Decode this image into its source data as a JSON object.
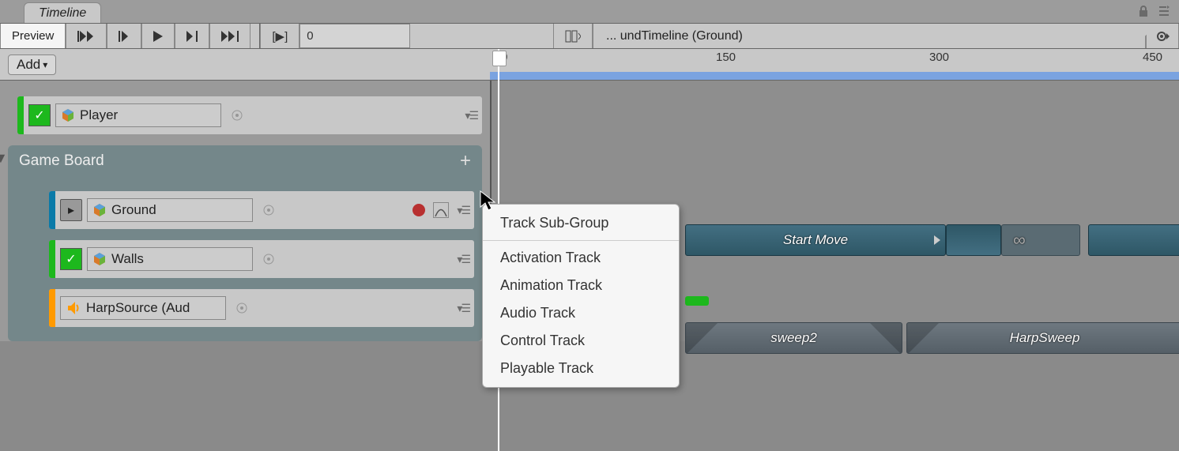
{
  "tab": {
    "title": "Timeline"
  },
  "toolbar": {
    "preview": "Preview",
    "frame": "0",
    "breadcrumb_text": "... undTimeline (Ground)"
  },
  "add_button": "Add",
  "ruler": {
    "ticks": [
      "0",
      "150",
      "300",
      "450"
    ]
  },
  "tracks": {
    "player": "Player",
    "group_name": "Game Board",
    "ground": "Ground",
    "walls": "Walls",
    "harp": "HarpSource (Aud"
  },
  "clips": {
    "start_move": "Start Move",
    "sweep2": "sweep2",
    "harp_sweep": "HarpSweep"
  },
  "context_menu": {
    "sub_group": "Track Sub-Group",
    "activation": "Activation Track",
    "animation": "Animation Track",
    "audio": "Audio Track",
    "control": "Control Track",
    "playable": "Playable Track"
  }
}
